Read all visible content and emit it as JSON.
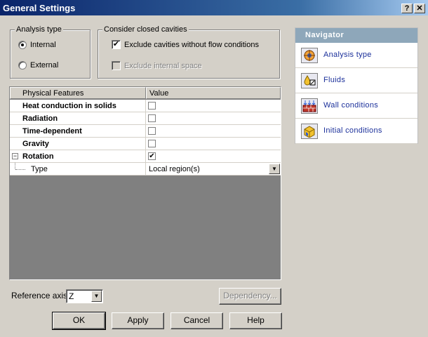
{
  "window": {
    "title": "General Settings",
    "help_btn": "?",
    "close_btn": "✕"
  },
  "analysis_type": {
    "legend": "Analysis type",
    "options": [
      {
        "label": "Internal",
        "selected": true
      },
      {
        "label": "External",
        "selected": false
      }
    ]
  },
  "cavities": {
    "legend": "Consider closed cavities",
    "exclude_no_flow": {
      "label": "Exclude cavities without flow conditions",
      "checked": true,
      "mark": "✔"
    },
    "exclude_internal": {
      "label": "Exclude internal space",
      "checked": false,
      "enabled": false
    }
  },
  "grid": {
    "columns": [
      "Physical Features",
      "Value"
    ],
    "rows": [
      {
        "name": "Heat conduction in solids",
        "checked": false,
        "mark": ""
      },
      {
        "name": "Radiation",
        "checked": false,
        "mark": ""
      },
      {
        "name": "Time-dependent",
        "checked": false,
        "mark": ""
      },
      {
        "name": "Gravity",
        "checked": false,
        "mark": ""
      },
      {
        "name": "Rotation",
        "checked": true,
        "mark": "✔",
        "expander": "−"
      }
    ],
    "subrow": {
      "name": "Type",
      "value": "Local region(s)"
    }
  },
  "reference_axis": {
    "label": "Reference axis:",
    "value": "Z"
  },
  "buttons": {
    "dependency": "Dependency...",
    "ok": "OK",
    "apply": "Apply",
    "cancel": "Cancel",
    "help": "Help"
  },
  "navigator": {
    "title": "Navigator",
    "items": [
      {
        "label": "Analysis type",
        "icon": "analysis-type-icon"
      },
      {
        "label": "Fluids",
        "icon": "fluids-icon"
      },
      {
        "label": " Wall conditions",
        "icon": "wall-conditions-icon"
      },
      {
        "label": "Initial conditions",
        "icon": "initial-conditions-icon"
      }
    ]
  },
  "colors": {
    "title_bar": "#0a246a",
    "navigator_header": "#8ea7ba",
    "navigator_link": "#1a2f9a",
    "dialog_bg": "#d4d0c8"
  }
}
